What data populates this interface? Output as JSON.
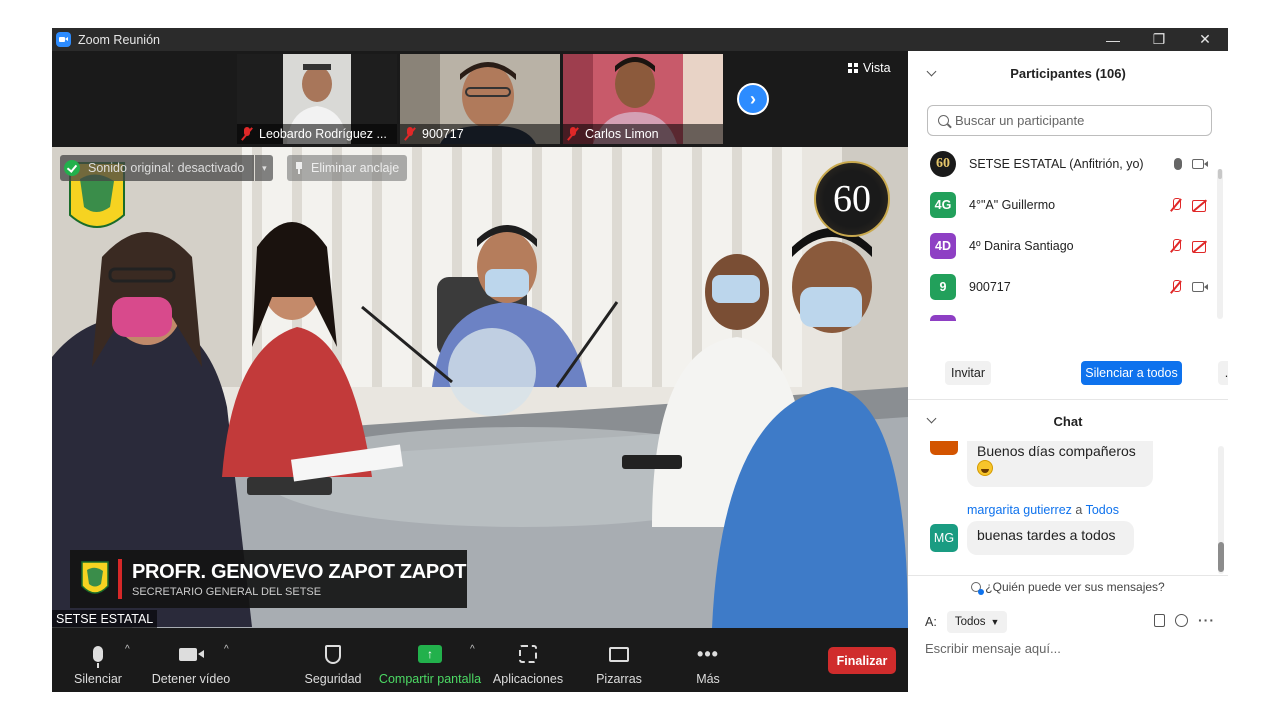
{
  "window": {
    "title": "Zoom Reunión",
    "controls": [
      "—",
      "❐",
      "✕"
    ]
  },
  "thumbnails": [
    {
      "name": "Leobardo Rodríguez ..."
    },
    {
      "name": "900717"
    },
    {
      "name": "Carlos Limon"
    }
  ],
  "view": {
    "label": "Vista"
  },
  "main_video": {
    "original_sound": "Sonido original: desactivado",
    "unpin": "Eliminar anclaje",
    "badge": "60",
    "speaker_name": "PROFR. GENOVEVO ZAPOT ZAPOT",
    "speaker_role": "SECRETARIO GENERAL DEL SETSE",
    "active_speaker": "SETSE ESTATAL"
  },
  "toolbar": {
    "mute": "Silenciar",
    "stop_video": "Detener vídeo",
    "security": "Seguridad",
    "share": "Compartir pantalla",
    "apps": "Aplicaciones",
    "whiteboards": "Pizarras",
    "more": "Más",
    "end": "Finalizar"
  },
  "participants": {
    "title": "Participantes (106)",
    "search_placeholder": "Buscar un participante",
    "list": [
      {
        "initials": "60",
        "name": "SETSE ESTATAL (Anfitrión, yo)",
        "color": "#1a1a1a"
      },
      {
        "initials": "4G",
        "name": "4°\"A\" Guillermo",
        "color": "#22a05b"
      },
      {
        "initials": "4D",
        "name": "4º Danira Santiago",
        "color": "#8e3fc4"
      },
      {
        "initials": "9",
        "name": "900717",
        "color": "#22a05b"
      }
    ],
    "invite": "Invitar",
    "mute_all": "Silenciar a todos",
    "more": "..."
  },
  "chat": {
    "title": "Chat",
    "messages": [
      {
        "text": "Buenos días compañeros",
        "avatar_color": "#d35400"
      },
      {
        "sender": "margarita gutierrez",
        "to_word": "a",
        "recipient": "Todos",
        "initials": "MG",
        "text": "buenas tardes a todos",
        "avatar_color": "#1a9c82"
      }
    ],
    "who_sees": "¿Quién puede ver sus mensajes?",
    "to_label": "A:",
    "to_value": "Todos",
    "compose_placeholder": "Escribir mensaje aquí..."
  }
}
